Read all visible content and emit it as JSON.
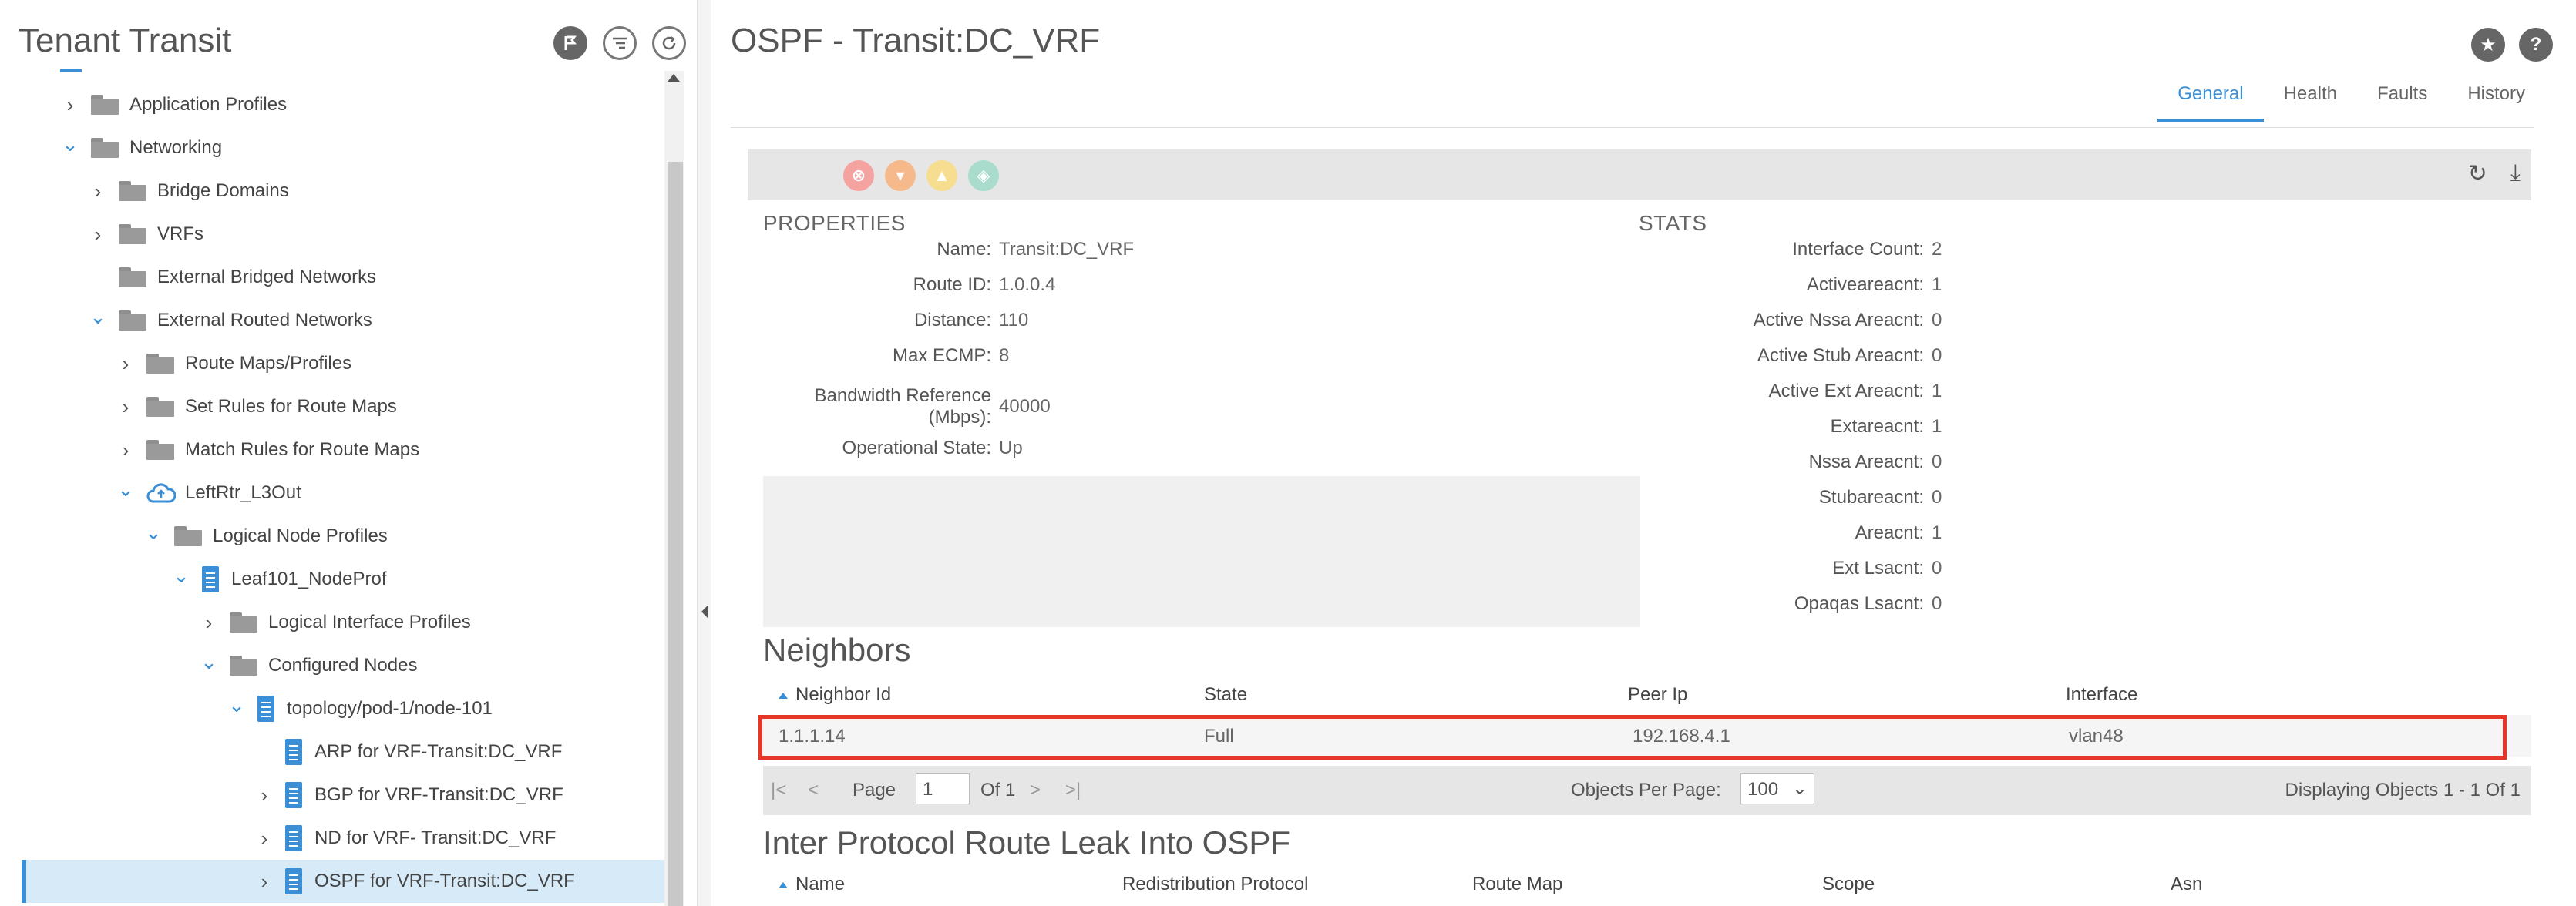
{
  "left": {
    "title": "Tenant Transit",
    "tree": [
      {
        "label": "Application Profiles",
        "indent": 0,
        "chev": "right",
        "icon": "folder"
      },
      {
        "label": "Networking",
        "indent": 0,
        "chev": "down",
        "icon": "folder"
      },
      {
        "label": "Bridge Domains",
        "indent": 1,
        "chev": "right",
        "icon": "folder"
      },
      {
        "label": "VRFs",
        "indent": 1,
        "chev": "right",
        "icon": "folder"
      },
      {
        "label": "External Bridged Networks",
        "indent": 1,
        "chev": "none",
        "icon": "folder"
      },
      {
        "label": "External Routed Networks",
        "indent": 1,
        "chev": "down",
        "icon": "folder"
      },
      {
        "label": "Route Maps/Profiles",
        "indent": 2,
        "chev": "right",
        "icon": "folder"
      },
      {
        "label": "Set Rules for Route Maps",
        "indent": 2,
        "chev": "right",
        "icon": "folder"
      },
      {
        "label": "Match Rules for Route Maps",
        "indent": 2,
        "chev": "right",
        "icon": "folder"
      },
      {
        "label": "LeftRtr_L3Out",
        "indent": 2,
        "chev": "down",
        "icon": "cloud"
      },
      {
        "label": "Logical Node Profiles",
        "indent": 3,
        "chev": "down",
        "icon": "folder"
      },
      {
        "label": "Leaf101_NodeProf",
        "indent": 4,
        "chev": "down",
        "icon": "doc"
      },
      {
        "label": "Logical Interface Profiles",
        "indent": 5,
        "chev": "right",
        "icon": "folder"
      },
      {
        "label": "Configured Nodes",
        "indent": 5,
        "chev": "down",
        "icon": "folder"
      },
      {
        "label": "topology/pod-1/node-101",
        "indent": 6,
        "chev": "down",
        "icon": "doc"
      },
      {
        "label": "ARP for VRF-Transit:DC_VRF",
        "indent": 7,
        "chev": "none",
        "icon": "doc"
      },
      {
        "label": "BGP for VRF-Transit:DC_VRF",
        "indent": 7,
        "chev": "right",
        "icon": "doc"
      },
      {
        "label": "ND for VRF- Transit:DC_VRF",
        "indent": 7,
        "chev": "right",
        "icon": "doc"
      },
      {
        "label": "OSPF for VRF-Transit:DC_VRF",
        "indent": 7,
        "chev": "right",
        "icon": "doc",
        "selected": true
      }
    ]
  },
  "right": {
    "title": "OSPF - Transit:DC_VRF",
    "tabs": [
      "General",
      "Health",
      "Faults",
      "History"
    ],
    "active_tab": "General",
    "properties_label": "PROPERTIES",
    "stats_label": "STATS",
    "properties": [
      {
        "key": "Name:",
        "value": "Transit:DC_VRF"
      },
      {
        "key": "Route ID:",
        "value": "1.0.0.4"
      },
      {
        "key": "Distance:",
        "value": "110"
      },
      {
        "key": "Max ECMP:",
        "value": "8"
      },
      {
        "key": "Bandwidth Reference",
        "key2": "(Mbps):",
        "value": "40000"
      },
      {
        "key": "Operational State:",
        "value": "Up"
      }
    ],
    "stats": [
      {
        "key": "Interface Count:",
        "value": "2"
      },
      {
        "key": "Activeareacnt:",
        "value": "1"
      },
      {
        "key": "Active Nssa Areacnt:",
        "value": "0"
      },
      {
        "key": "Active Stub Areacnt:",
        "value": "0"
      },
      {
        "key": "Active Ext Areacnt:",
        "value": "1"
      },
      {
        "key": "Extareacnt:",
        "value": "1"
      },
      {
        "key": "Nssa Areacnt:",
        "value": "0"
      },
      {
        "key": "Stubareacnt:",
        "value": "0"
      },
      {
        "key": "Areacnt:",
        "value": "1"
      },
      {
        "key": "Ext Lsacnt:",
        "value": "0"
      },
      {
        "key": "Opaqas Lsacnt:",
        "value": "0"
      }
    ],
    "neighbors": {
      "title": "Neighbors",
      "columns": [
        "Neighbor Id",
        "State",
        "Peer Ip",
        "Interface"
      ],
      "rows": [
        [
          "1.1.1.14",
          "Full",
          "192.168.4.1",
          "vlan48"
        ]
      ],
      "pager": {
        "page_label": "Page",
        "page_value": "1",
        "of_label": "Of 1",
        "per_page_label": "Objects Per Page:",
        "per_page_value": "100",
        "displaying": "Displaying Objects 1 - 1 Of 1"
      }
    },
    "leak": {
      "title": "Inter Protocol Route Leak Into OSPF",
      "columns": [
        "Name",
        "Redistribution Protocol",
        "Route Map",
        "Scope",
        "Asn"
      ]
    }
  },
  "colors": {
    "accent": "#3a8fd6",
    "highlight": "#e8352a",
    "fault_critical": "#f5a3a0",
    "fault_major": "#f6b98c",
    "fault_minor": "#f6dd8f",
    "fault_warning": "#a9dccc"
  }
}
